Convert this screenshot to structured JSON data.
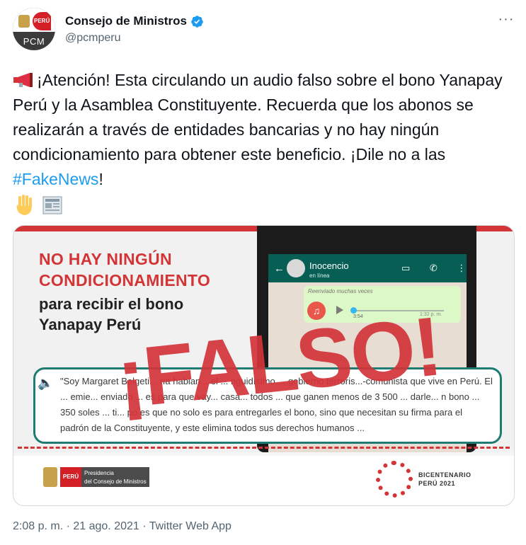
{
  "author": {
    "display_name": "Consejo de Ministros",
    "handle": "@pcmperu",
    "avatar_flag_text": "PERÚ",
    "avatar_label": "PCM",
    "verified": true
  },
  "tweet": {
    "text_before_hashtag": "¡Atención! Esta circulando un audio falso sobre el bono Yanapay Perú y la Asamblea Constituyente. Recuerda que los abonos se realizarán a través de entidades bancarias y no hay ningún condicionamiento para obtener este beneficio. ¡Dile no a las ",
    "hashtag": "#FakeNews",
    "text_after_hashtag": "!",
    "emojis": [
      "megaphone-icon",
      "raised-hand-icon",
      "newspaper-icon"
    ]
  },
  "media": {
    "headline_red_1": "NO HAY NINGÚN",
    "headline_red_2": "CONDICIONAMIENTO",
    "headline_dark_1": "para recibir el bono",
    "headline_dark_2": "Yanapay Perú",
    "stamp": "¡FALSO!",
    "chat": {
      "contact_name": "Inocencio",
      "contact_status": "en línea",
      "forwarded": "Reenviado muchas veces",
      "duration": "3:54",
      "time": "1:32 p. m."
    },
    "quote": "\"Soy Margaret Belgeti... ría hablan... el ... nguidísimo ... gobierno terroris...-comunista que vive en Perú. El ... emie... enviado ... es para que vay... casa... todos ... que ganen menos de 3 500 ... darle... n bono ... 350 soles ... ti... po es que no solo es para entregarles el bono, sino que necesitan su firma para el padrón de la Constituyente, y este elimina todos sus derechos humanos ...",
    "footer_left_badge": "PERÚ",
    "footer_left_name_1": "Presidencia",
    "footer_left_name_2": "del Consejo de Ministros",
    "footer_right_1": "BICENTENARIO",
    "footer_right_2": "PERÚ 2021"
  },
  "meta": "2:08 p. m. · 21 ago. 2021 · Twitter Web App",
  "colors": {
    "link": "#1d9bf0",
    "accent_red": "#d33536",
    "whatsapp_green": "#075e54"
  }
}
